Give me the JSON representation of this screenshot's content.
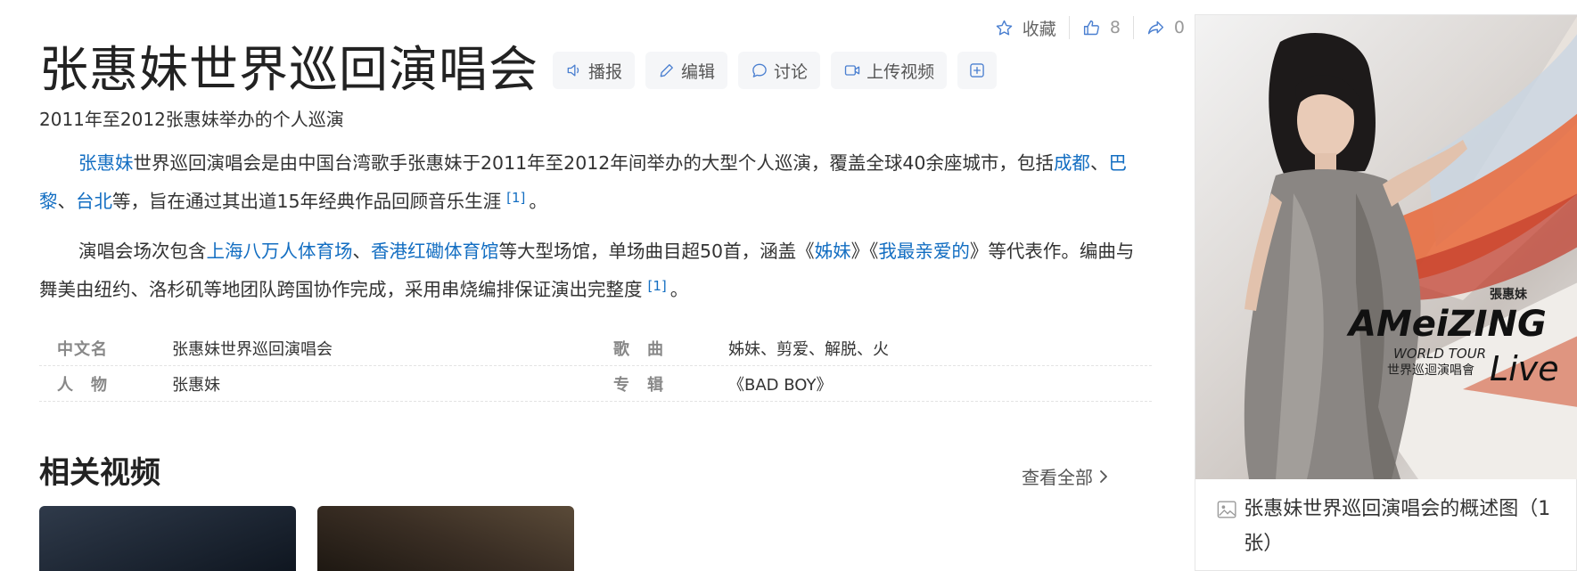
{
  "top_actions": {
    "collect_label": "收藏",
    "like_count": "8",
    "share_count": "0"
  },
  "title": "张惠妹世界巡回演唱会",
  "tools": {
    "broadcast": "播报",
    "edit": "编辑",
    "discuss": "讨论",
    "upload_video": "上传视频"
  },
  "subtitle": "2011年至2012张惠妹举办的个人巡演",
  "para1": {
    "link1": "张惠妹",
    "text1": "世界巡回演唱会是由中国台湾歌手张惠妹于2011年至2012年间举办的大型个人巡演，覆盖全球40余座城市，包括",
    "link2": "成都",
    "sep1": "、",
    "link3": "巴黎",
    "sep2": "、",
    "link4": "台北",
    "text2": "等，旨在通过其出道15年经典作品回顾音乐生涯",
    "ref": "[1]",
    "end": "。"
  },
  "para2": {
    "text1": "演唱会场次包含",
    "link1": "上海八万人体育场",
    "sep1": "、",
    "link2": "香港红磡体育馆",
    "text2": "等大型场馆，单场曲目超50首，涵盖《",
    "link3": "姊妹",
    "text3": "》《",
    "link4": "我最亲爱的",
    "text4": "》等代表作。编曲与舞美由纽约、洛杉矶等地团队跨国协作完成，采用串烧编排保证演出完整度",
    "ref": "[1]",
    "end": "。"
  },
  "infobox": {
    "rows": [
      [
        {
          "key": "中文名",
          "value": "张惠妹世界巡回演唱会"
        },
        {
          "key": "歌　曲",
          "value": "姊妹、剪爱、解脱、火"
        }
      ],
      [
        {
          "key": "人　物",
          "value": "张惠妹"
        },
        {
          "key": "专　辑",
          "value": "《BAD BOY》"
        }
      ]
    ]
  },
  "related_videos": {
    "title": "相关视频",
    "view_all": "查看全部"
  },
  "side_panel": {
    "image_text": {
      "artist": "張惠妹",
      "brand": "AMeiZING",
      "tour": "WORLD TOUR",
      "cn": "世界巡迴演唱會",
      "live": "Live"
    },
    "caption": "张惠妹世界巡回演唱会的概述图（1张）"
  },
  "colors": {
    "link": "#136ec2",
    "tool_bg": "#f5f6f8"
  }
}
